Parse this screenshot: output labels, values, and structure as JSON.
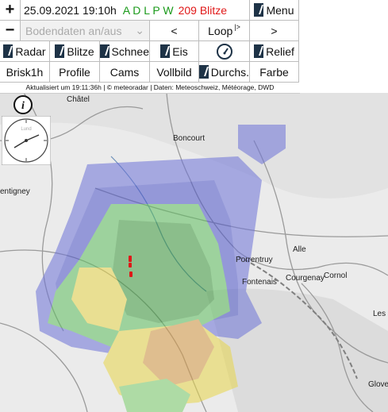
{
  "header": {
    "plus_label": "+",
    "minus_label": "−",
    "datetime": "25.09.2021 19:10h",
    "sources": "A D L P W",
    "lightning_count": "209 Blitze",
    "menu_label": "Menu",
    "bodendaten_label": "Bodendaten an/aus",
    "prev_label": "<",
    "loop_label": "Loop",
    "loop_icon": "|>",
    "next_label": ">"
  },
  "layers": {
    "radar": "Radar",
    "blitze": "Blitze",
    "schnee": "Schnee",
    "eis": "Eis",
    "relief": "Relief"
  },
  "views": {
    "brisk": "Brisk1h",
    "profile": "Profile",
    "cams": "Cams",
    "vollbild": "Vollbild",
    "durchs": "Durchs.",
    "farbe": "Farbe"
  },
  "status_text": "Aktualisiert um 19:11:36h | © meteoradar | Daten: Meteoschweiz, Météorage, DWD",
  "map": {
    "places": [
      "Châtel",
      "Boncourt",
      "entigney",
      "Porrentruy",
      "Fontenais",
      "Alle",
      "Courgenay",
      "Cornol",
      "Les",
      "Glove"
    ],
    "clock_label": "Lund"
  },
  "colors": {
    "accent": "#1e3347",
    "lightning": "#e01818",
    "sources": "#1a9a1a"
  },
  "icons": [
    "info-icon",
    "gauge-icon",
    "clock-icon",
    "loop-play-icon"
  ]
}
